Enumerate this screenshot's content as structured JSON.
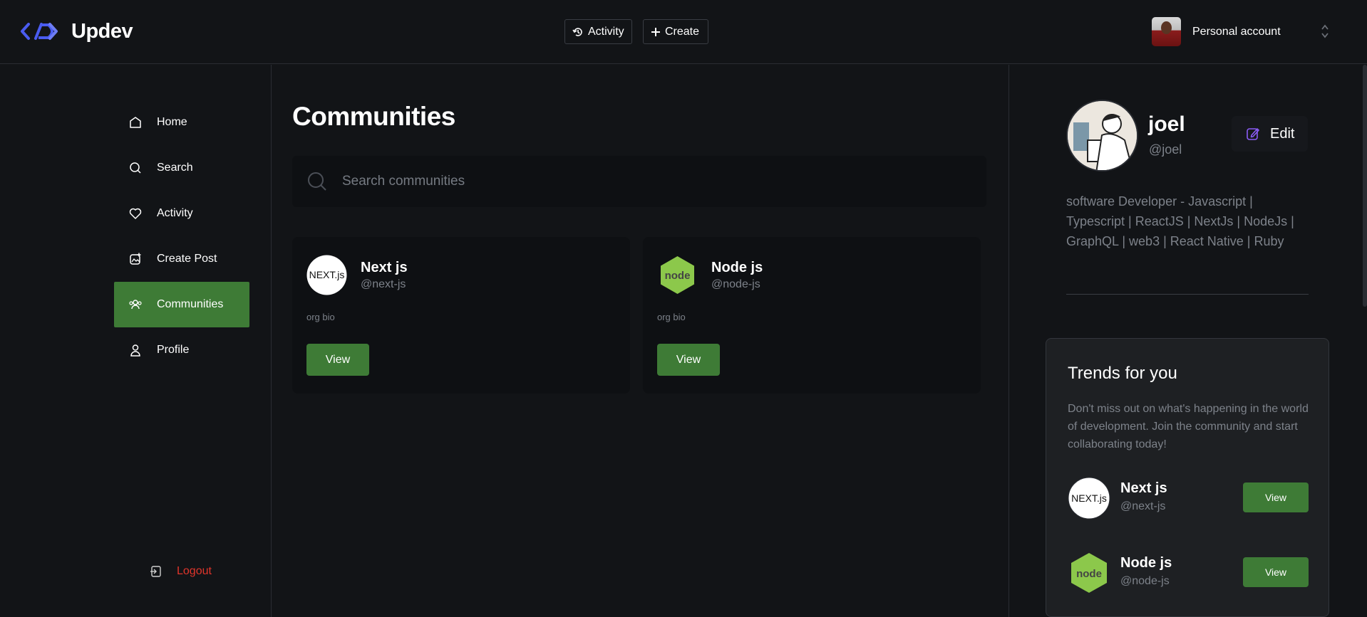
{
  "header": {
    "brand": "Updev",
    "activity_label": "Activity",
    "create_label": "Create",
    "account_label": "Personal account"
  },
  "sidebar": {
    "items": [
      {
        "label": "Home",
        "icon": "home-icon"
      },
      {
        "label": "Search",
        "icon": "search-icon"
      },
      {
        "label": "Activity",
        "icon": "heart-icon"
      },
      {
        "label": "Create Post",
        "icon": "create-post-icon"
      },
      {
        "label": "Communities",
        "icon": "communities-icon",
        "active": true
      },
      {
        "label": "Profile",
        "icon": "user-icon"
      }
    ],
    "logout_label": "Logout"
  },
  "main": {
    "title": "Communities",
    "search_placeholder": "Search communities",
    "communities": [
      {
        "name": "Next js",
        "handle": "@next-js",
        "bio": "org bio",
        "button": "View",
        "logo_text": "NEXT.js"
      },
      {
        "name": "Node js",
        "handle": "@node-js",
        "bio": "org bio",
        "button": "View",
        "logo_text": "node"
      }
    ]
  },
  "profile": {
    "name": "joel",
    "handle": "@joel",
    "edit_label": "Edit",
    "bio": "software Developer - Javascript | Typescript | ReactJS | NextJs | NodeJs | GraphQL | web3 | React Native | Ruby"
  },
  "trends": {
    "title": "Trends for you",
    "description": "Don't miss out on what's happening in the world of development. Join the community and start collaborating today!",
    "items": [
      {
        "name": "Next js",
        "handle": "@next-js",
        "button": "View",
        "logo_text": "NEXT.js"
      },
      {
        "name": "Node js",
        "handle": "@node-js",
        "button": "View",
        "logo_text": "node"
      }
    ]
  },
  "colors": {
    "accent_green": "#3e7b36",
    "logout_red": "#e0352b",
    "logo_blue": "#4a5cf0",
    "edit_icon_purple": "#8b5cf6",
    "node_green": "#8cc84b"
  }
}
